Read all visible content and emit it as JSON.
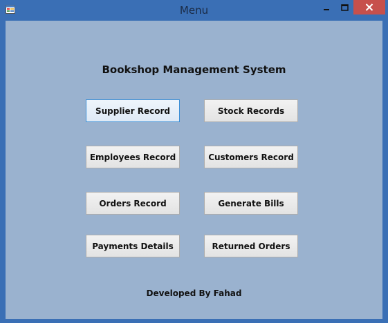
{
  "window": {
    "title": "Menu",
    "controls": {
      "minimize_icon": "minimize-icon",
      "maximize_icon": "maximize-icon",
      "close_icon": "close-icon"
    },
    "app_icon": "form-icon"
  },
  "main": {
    "heading": "Bookshop Management System",
    "buttons": [
      {
        "label": "Supplier Record"
      },
      {
        "label": "Stock Records"
      },
      {
        "label": "Employees Record"
      },
      {
        "label": "Customers Record"
      },
      {
        "label": "Orders Record"
      },
      {
        "label": "Generate Bills"
      },
      {
        "label": "Payments Details"
      },
      {
        "label": "Returned Orders"
      }
    ],
    "footer": "Developed By Fahad"
  },
  "colors": {
    "titlebar": "#3a6fb5",
    "client_background": "#9ab2cf",
    "close_button": "#c7504c",
    "focus_border": "#3c8fd6"
  }
}
